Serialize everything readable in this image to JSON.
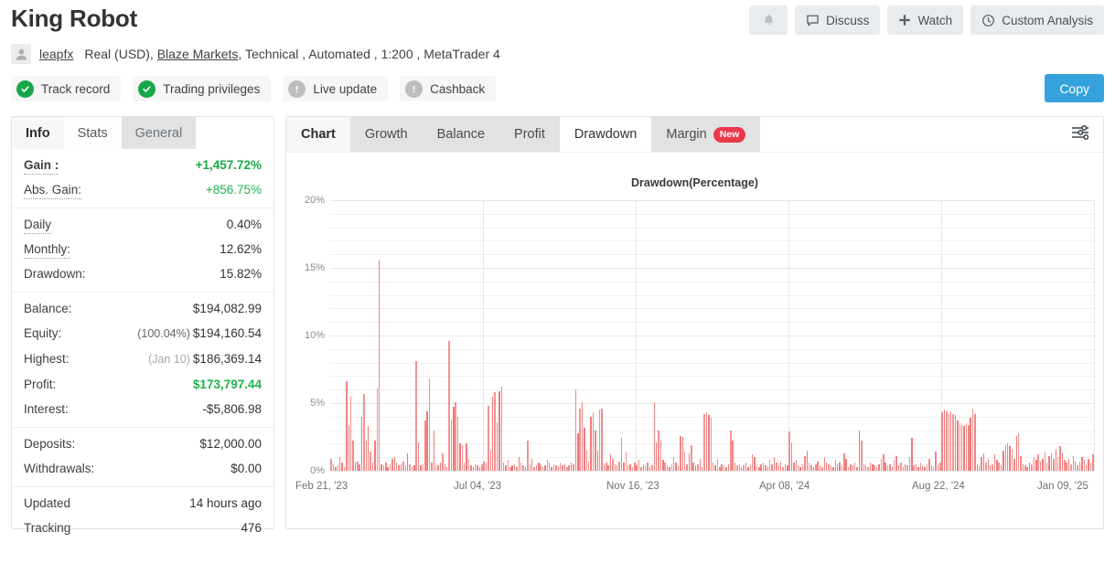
{
  "header": {
    "title": "King Robot",
    "actions": [
      {
        "label": "",
        "icon": "bell-icon",
        "name": "notifications-button"
      },
      {
        "label": "Discuss",
        "icon": "comment-icon",
        "name": "discuss-button"
      },
      {
        "label": "Watch",
        "icon": "plus-icon",
        "name": "watch-button"
      },
      {
        "label": "Custom Analysis",
        "icon": "clock-icon",
        "name": "custom-analysis-button"
      }
    ],
    "account": {
      "avatar_icon": "user-avatar-icon",
      "username": "leapfx",
      "type": "Real (USD),",
      "broker": "Blaze Markets",
      "rest": ", Technical , Automated , 1:200 , MetaTrader 4"
    },
    "badges": [
      {
        "label": "Track record",
        "state": "ok",
        "icon": "check-circle-icon"
      },
      {
        "label": "Trading privileges",
        "state": "ok",
        "icon": "check-circle-icon"
      },
      {
        "label": "Live update",
        "state": "off",
        "icon": "exclamation-circle-icon"
      },
      {
        "label": "Cashback",
        "state": "off",
        "icon": "exclamation-circle-icon"
      }
    ],
    "copy_label": "Copy"
  },
  "info_panel": {
    "tabs": [
      {
        "label": "Info",
        "active": true
      },
      {
        "label": "Stats",
        "active": false
      },
      {
        "label": "General",
        "active": false
      }
    ],
    "groups": [
      {
        "rows": [
          {
            "label": "Gain :",
            "value": "+1,457.72%",
            "style": "green",
            "label_style": "bold dotted"
          },
          {
            "label": "Abs. Gain:",
            "value": "+856.75%",
            "style": "greenlite",
            "label_style": "dotted"
          }
        ]
      },
      {
        "rows": [
          {
            "label": "Daily",
            "value": "0.40%",
            "style": "",
            "label_style": "dotted"
          },
          {
            "label": "Monthly:",
            "value": "12.62%",
            "style": "",
            "label_style": "dotted"
          },
          {
            "label": "Drawdown:",
            "value": "15.82%",
            "style": "",
            "label_style": ""
          }
        ]
      },
      {
        "rows": [
          {
            "label": "Balance:",
            "value": "$194,082.99",
            "style": "",
            "label_style": ""
          },
          {
            "label": "Equity:",
            "value": "$194,160.54",
            "sub": "(100.04%)",
            "sub_style": "dark",
            "style": "",
            "label_style": ""
          },
          {
            "label": "Highest:",
            "value": "$186,369.14",
            "sub": "(Jan 10)",
            "sub_style": "",
            "style": "",
            "label_style": ""
          },
          {
            "label": "Profit:",
            "value": "$173,797.44",
            "style": "greenlite bold",
            "label_style": ""
          },
          {
            "label": "Interest:",
            "value": "-$5,806.98",
            "style": "",
            "label_style": ""
          }
        ]
      },
      {
        "rows": [
          {
            "label": "Deposits:",
            "value": "$12,000.00",
            "style": "",
            "label_style": ""
          },
          {
            "label": "Withdrawals:",
            "value": "$0.00",
            "style": "",
            "label_style": ""
          }
        ]
      },
      {
        "rows": [
          {
            "label": "Updated",
            "value": "14 hours ago",
            "style": "",
            "label_style": ""
          },
          {
            "label": "Tracking",
            "value": "476",
            "style": "",
            "label_style": ""
          }
        ]
      }
    ]
  },
  "chart_panel": {
    "tabs": [
      {
        "label": "Chart",
        "state": "first"
      },
      {
        "label": "Growth",
        "state": ""
      },
      {
        "label": "Balance",
        "state": ""
      },
      {
        "label": "Profit",
        "state": ""
      },
      {
        "label": "Drawdown",
        "state": "active"
      },
      {
        "label": "Margin",
        "state": "",
        "badge": "New"
      }
    ],
    "settings_icon": "sliders-icon"
  },
  "chart_data": {
    "type": "bar",
    "title": "Drawdown(Percentage)",
    "xlabel": "",
    "ylabel": "",
    "ylim": [
      0,
      20
    ],
    "yticks": [
      0,
      5,
      10,
      15,
      20
    ],
    "ytick_labels": [
      "0%",
      "5%",
      "10%",
      "15%",
      "20%"
    ],
    "minor_gridlines": true,
    "grid": true,
    "legend": "none",
    "color": "#ef6a6a",
    "xtick_labels": [
      "Feb 21, '23",
      "Jul 04, '23",
      "Nov 16, '23",
      "Apr 08, '24",
      "Aug 22, '24",
      "Jan 09, '25"
    ],
    "xtick_positions": [
      0,
      0.2,
      0.4,
      0.6,
      0.8,
      1.0
    ],
    "x_start": "Feb 21, '23",
    "x_end": "Jan 09, '25",
    "note": "values are daily drawdown percent, read off the y-axis; 340 samples spanning Feb 2023 - Jan 2025",
    "values": [
      0.9,
      0.5,
      0.3,
      0.4,
      1.0,
      0.6,
      0.3,
      6.6,
      3.4,
      5.5,
      2.2,
      0.6,
      0.7,
      0.5,
      4.0,
      5.7,
      2.2,
      3.3,
      1.4,
      0.6,
      2.2,
      6.1,
      15.6,
      0.5,
      0.4,
      0.6,
      0.3,
      0.5,
      0.9,
      1.0,
      0.6,
      0.4,
      0.5,
      0.7,
      0.4,
      1.3,
      0.5,
      0.3,
      0.4,
      8.1,
      2.1,
      0.4,
      0.5,
      3.7,
      4.4,
      6.8,
      0.6,
      3.0,
      0.5,
      0.4,
      0.6,
      1.3,
      0.5,
      0.3,
      9.6,
      3.8,
      4.7,
      5.1,
      4.0,
      2.0,
      1.9,
      0.6,
      2.0,
      0.9,
      0.4,
      0.3,
      0.5,
      0.4,
      0.3,
      0.5,
      0.7,
      0.6,
      4.8,
      1.5,
      5.5,
      5.8,
      3.6,
      5.9,
      6.2,
      0.6,
      0.4,
      0.8,
      0.3,
      0.4,
      0.5,
      0.3,
      1.0,
      0.6,
      0.4,
      0.3,
      2.2,
      0.5,
      0.9,
      0.3,
      0.4,
      0.6,
      0.5,
      0.3,
      0.4,
      0.8,
      0.6,
      0.3,
      0.5,
      0.4,
      0.3,
      0.6,
      0.4,
      0.5,
      0.3,
      0.4,
      0.6,
      0.5,
      6.0,
      2.8,
      4.6,
      5.1,
      3.2,
      1.5,
      0.7,
      4.0,
      4.3,
      3.0,
      1.5,
      4.5,
      4.6,
      0.5,
      0.6,
      0.4,
      1.2,
      0.9,
      0.5,
      0.4,
      0.7,
      2.4,
      0.6,
      1.4,
      0.4,
      0.5,
      0.3,
      0.6,
      0.4,
      0.8,
      0.3,
      0.5,
      0.4,
      0.6,
      0.3,
      0.4,
      5.1,
      2.1,
      3.0,
      2.3,
      0.8,
      0.6,
      0.4,
      0.3,
      0.5,
      1.0,
      0.6,
      0.4,
      2.6,
      2.5,
      1.4,
      0.5,
      1.3,
      1.9,
      0.6,
      0.4,
      0.5,
      0.9,
      0.3,
      4.2,
      4.3,
      4.1,
      3.9,
      0.6,
      0.4,
      0.9,
      0.3,
      0.5,
      0.4,
      0.3,
      0.5,
      3.0,
      2.2,
      0.6,
      0.4,
      0.5,
      0.3,
      0.4,
      0.6,
      0.3,
      0.5,
      1.2,
      1.0,
      0.4,
      0.3,
      0.5,
      0.6,
      0.4,
      0.3,
      0.8,
      0.5,
      1.0,
      0.6,
      0.4,
      0.7,
      0.3,
      0.5,
      0.4,
      2.9,
      2.1,
      0.6,
      0.8,
      0.4,
      0.3,
      0.5,
      1.1,
      1.5,
      0.6,
      0.4,
      0.3,
      0.5,
      0.7,
      0.4,
      0.3,
      1.0,
      0.6,
      0.5,
      0.4,
      0.3,
      0.8,
      0.5,
      0.6,
      0.4,
      1.3,
      0.9,
      0.3,
      0.5,
      0.4,
      0.6,
      0.3,
      3.0,
      2.2,
      0.5,
      0.4,
      0.3,
      0.6,
      0.5,
      0.4,
      0.3,
      0.5,
      0.9,
      1.2,
      0.6,
      0.4,
      0.5,
      0.3,
      0.8,
      1.1,
      0.4,
      0.6,
      0.3,
      0.5,
      0.4,
      1.0,
      2.4,
      0.4,
      0.5,
      0.3,
      0.6,
      0.4,
      0.3,
      0.5,
      0.9,
      0.4,
      0.3,
      1.4,
      0.5,
      0.6,
      4.3,
      4.5,
      4.4,
      4.2,
      4.4,
      4.2,
      4.1,
      3.7,
      3.5,
      3.4,
      3.3,
      3.5,
      3.4,
      3.9,
      4.6,
      4.2,
      0.5,
      0.4,
      1.0,
      1.3,
      0.6,
      0.9,
      0.4,
      0.5,
      1.2,
      0.8,
      0.6,
      0.4,
      1.5,
      1.9,
      2.0,
      1.8,
      1.6,
      0.9,
      2.6,
      2.8,
      1.1,
      0.5,
      0.4,
      0.3,
      0.6,
      0.5,
      1.0,
      0.8,
      1.2,
      0.7,
      0.9,
      1.4,
      0.6,
      1.1,
      1.3,
      0.9,
      1.6,
      1.0,
      1.8,
      1.3,
      0.8,
      0.6,
      0.9,
      0.5,
      1.1,
      0.7,
      0.4,
      0.6,
      1.0,
      0.8,
      0.5,
      0.9,
      0.6,
      1.2
    ]
  }
}
